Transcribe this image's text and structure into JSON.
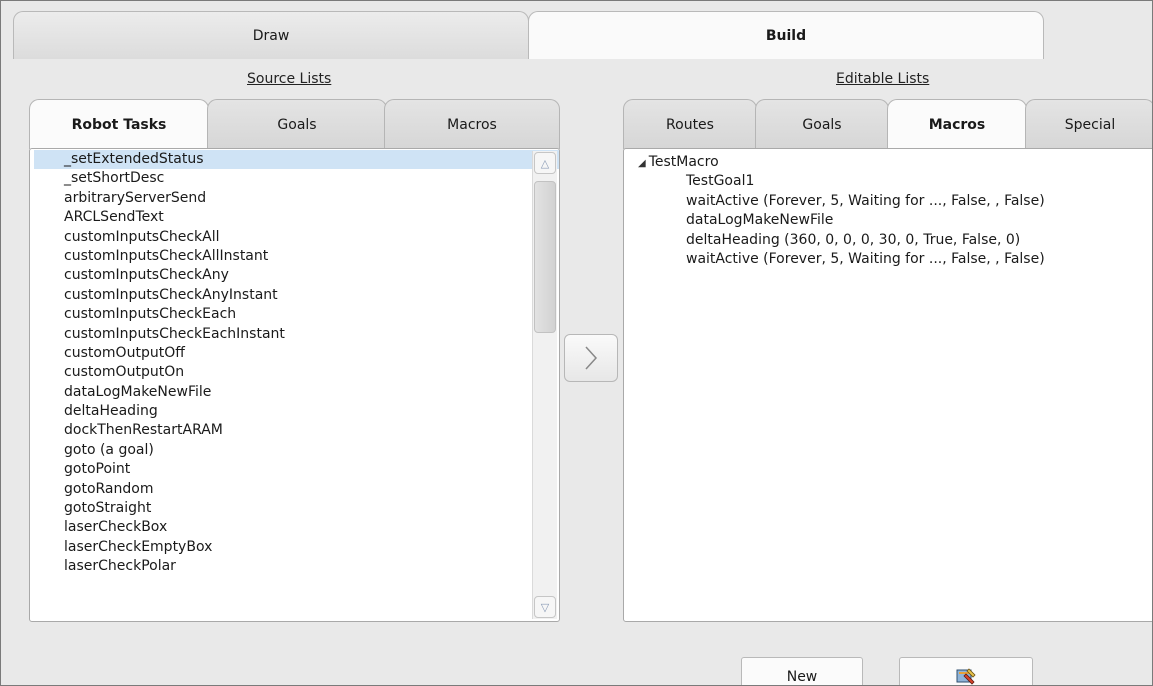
{
  "top_tabs": [
    {
      "label": "Draw",
      "active": false
    },
    {
      "label": "Build",
      "active": true
    }
  ],
  "source_lists": {
    "title": "Source Lists",
    "tabs": [
      {
        "label": "Robot Tasks",
        "active": true
      },
      {
        "label": "Goals",
        "active": false
      },
      {
        "label": "Macros",
        "active": false
      }
    ],
    "items": [
      "_setExtendedStatus",
      "_setShortDesc",
      "arbitraryServerSend",
      "ARCLSendText",
      "customInputsCheckAll",
      "customInputsCheckAllInstant",
      "customInputsCheckAny",
      "customInputsCheckAnyInstant",
      "customInputsCheckEach",
      "customInputsCheckEachInstant",
      "customOutputOff",
      "customOutputOn",
      "dataLogMakeNewFile",
      "deltaHeading",
      "dockThenRestartARAM",
      "goto (a goal)",
      "gotoPoint",
      "gotoRandom",
      "gotoStraight",
      "laserCheckBox",
      "laserCheckEmptyBox",
      "laserCheckPolar"
    ],
    "selected_item": "_setExtendedStatus"
  },
  "transfer_button": {
    "icon": "chevron-right-icon"
  },
  "editable_lists": {
    "title": "Editable Lists",
    "tabs": [
      {
        "label": "Routes",
        "active": false
      },
      {
        "label": "Goals",
        "active": false
      },
      {
        "label": "Macros",
        "active": true
      },
      {
        "label": "Special",
        "active": false
      }
    ],
    "tree": {
      "root": "TestMacro",
      "expanded": true,
      "children": [
        "TestGoal1",
        "waitActive (Forever, 5, Waiting for ..., False, , False)",
        "dataLogMakeNewFile",
        "deltaHeading (360, 0, 0, 0, 30, 0, True, False, 0)",
        "waitActive (Forever, 5, Waiting for ..., False, , False)"
      ]
    }
  },
  "bottom_buttons": {
    "new_label": "New",
    "edit_icon": "edit-tool-icon"
  },
  "colors": {
    "background": "#e9e9e9",
    "selection": "#cfe3f5",
    "panel": "#ffffff"
  }
}
